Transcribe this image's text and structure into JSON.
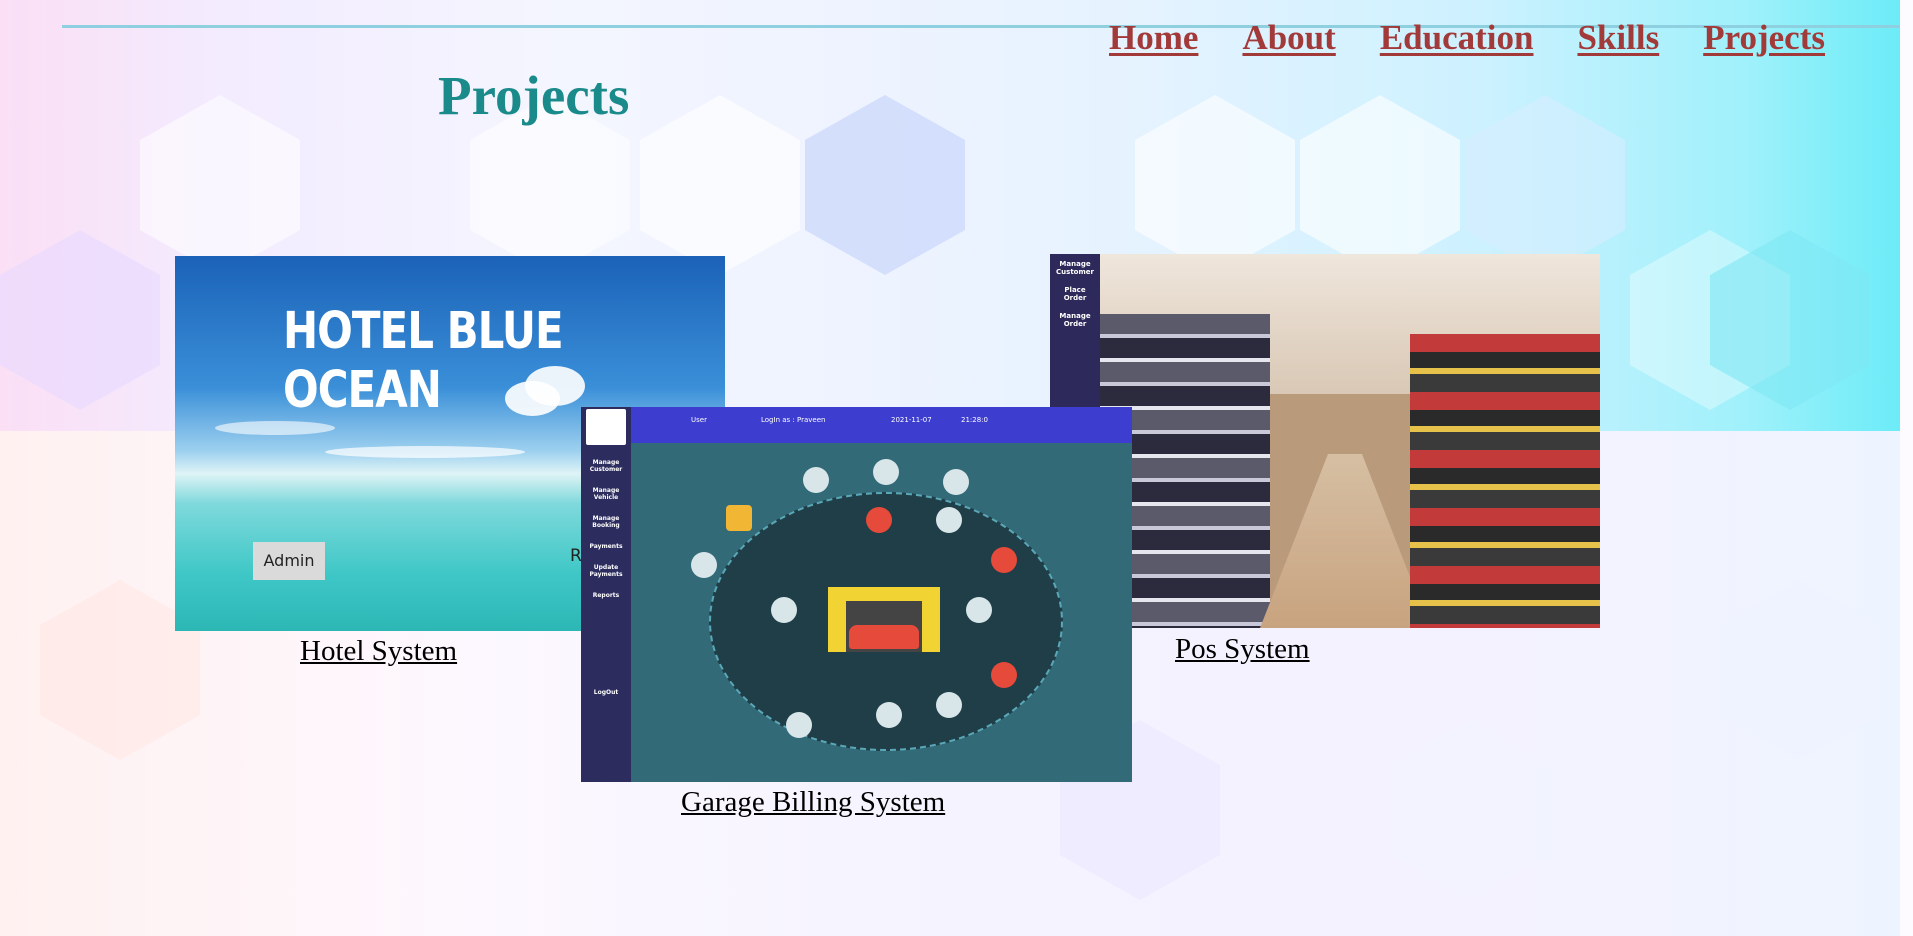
{
  "nav": {
    "items": [
      "Home",
      "About",
      "Education",
      "Skills",
      "Projects"
    ]
  },
  "page": {
    "title": "Projects"
  },
  "projects": [
    {
      "caption": "Hotel System",
      "screenshot": {
        "heading": "HOTEL BLUE OCEAN",
        "button_admin": "Admin",
        "button_partial": "Re"
      }
    },
    {
      "caption": "Garage Billing System",
      "screenshot": {
        "topbar": [
          "User",
          "LogIn as : Praveen",
          "2021-11-07",
          "21:28:0"
        ],
        "sidebar": [
          "Manage Customer",
          "Manage Vehicle",
          "Manage Booking",
          "Payments",
          "Update Payments",
          "Reports",
          "LogOut"
        ]
      }
    },
    {
      "caption": "Pos System",
      "screenshot": {
        "sidebar": [
          "Manage Customer",
          "Place Order",
          "Manage Order"
        ]
      }
    }
  ]
}
